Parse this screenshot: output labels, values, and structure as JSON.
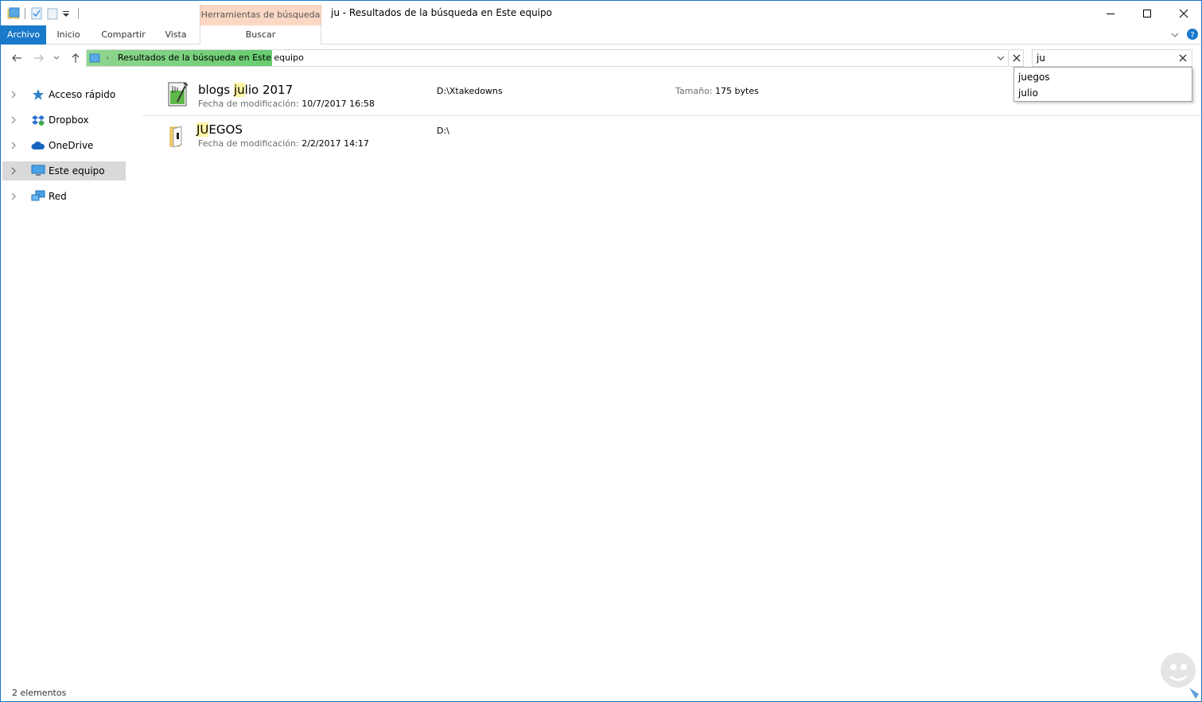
{
  "window": {
    "title": "ju - Resultados de la búsqueda en Este equipo",
    "context_tab_group": "Herramientas de búsqueda",
    "accent": "#1979ca"
  },
  "ribbon": {
    "tabs": [
      {
        "label": "Archivo"
      },
      {
        "label": "Inicio"
      },
      {
        "label": "Compartir"
      },
      {
        "label": "Vista"
      },
      {
        "label": "Buscar"
      }
    ]
  },
  "address": {
    "location_icon": "this-pc-icon",
    "path": "Resultados de la búsqueda en Este equipo",
    "progress_color": "#68cc6f"
  },
  "search": {
    "value": "ju",
    "suggestions": [
      "juegos",
      "julio"
    ]
  },
  "nav": {
    "items": [
      {
        "label": "Acceso rápido",
        "icon": "star-icon"
      },
      {
        "label": "Dropbox",
        "icon": "dropbox-icon"
      },
      {
        "label": "OneDrive",
        "icon": "cloud-icon"
      },
      {
        "label": "Este equipo",
        "icon": "computer-icon",
        "selected": true
      },
      {
        "label": "Red",
        "icon": "network-icon"
      }
    ]
  },
  "results": [
    {
      "name_pre": "blogs ",
      "name_hl": "ju",
      "name_post": "lio 2017",
      "modified_label": "Fecha de modificación:",
      "modified": "10/7/2017 16:58",
      "path": "D:\\Xtakedowns",
      "size_label": "Tamaño:",
      "size": "175 bytes",
      "icon": "notepad-plus-file-icon"
    },
    {
      "name_pre": "",
      "name_hl": "JU",
      "name_post": "EGOS",
      "modified_label": "Fecha de modificación:",
      "modified": "2/2/2017 14:17",
      "path": "D:\\",
      "icon": "folder-icon"
    }
  ],
  "status": {
    "count": "2 elementos"
  }
}
